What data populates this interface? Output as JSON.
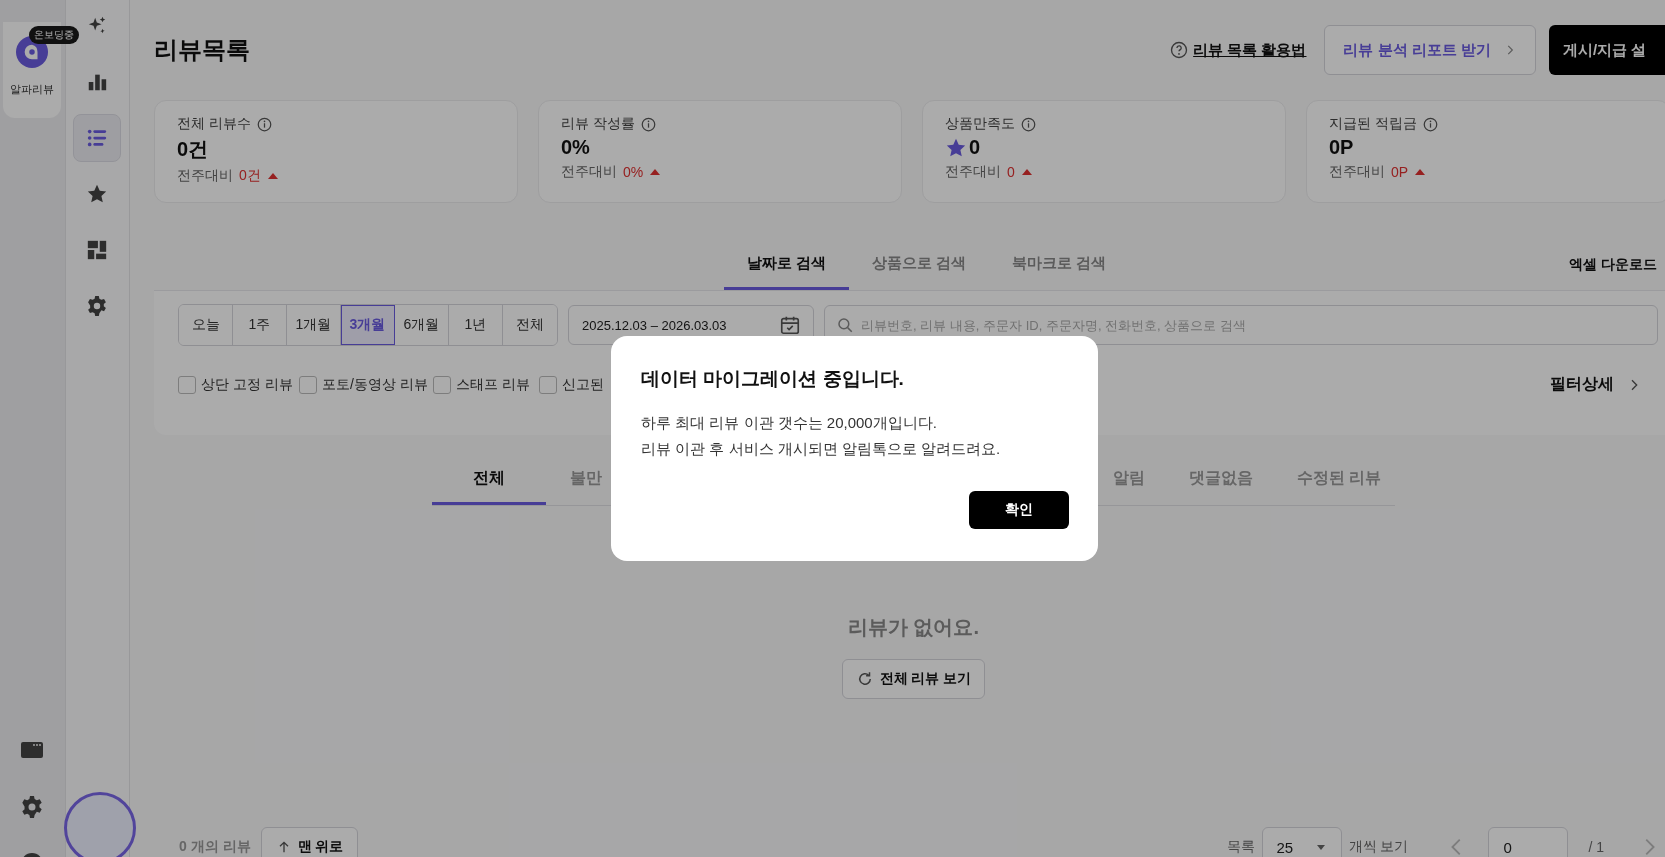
{
  "app_rail": {
    "badge": "온보딩중",
    "app_name": "알파리뷰"
  },
  "nav_items": [
    {
      "selected": false
    },
    {
      "selected": false
    },
    {
      "selected": true
    },
    {
      "selected": false
    },
    {
      "selected": false
    },
    {
      "selected": false
    }
  ],
  "header": {
    "title": "리뷰목록",
    "help_link": "리뷰 목록 활용법",
    "report_button": "리뷰 분석 리포트 받기",
    "settings_button": "게시/지급 설"
  },
  "stats": [
    {
      "kind": "count",
      "label": "전체 리뷰수",
      "value": "0건",
      "compare_label": "전주대비",
      "change": "0건",
      "rising": true
    },
    {
      "kind": "count",
      "label": "리뷰 작성률",
      "value": "0%",
      "compare_label": "전주대비",
      "change": "0%",
      "rising": true
    },
    {
      "kind": "rating",
      "label": "상품만족도",
      "value": "0",
      "compare_label": "전주대비",
      "change": "0",
      "rising": true
    },
    {
      "kind": "count",
      "label": "지급된 적립금",
      "value": "0P",
      "compare_label": "전주대비",
      "change": "0P",
      "rising": true
    }
  ],
  "search_tabs": [
    {
      "label": "날짜로 검색",
      "selected": true
    },
    {
      "label": "상품으로 검색",
      "selected": false
    },
    {
      "label": "북마크로 검색",
      "selected": false
    }
  ],
  "excel_download": "엑셀 다운로드",
  "periods": [
    {
      "label": "오늘",
      "selected": false
    },
    {
      "label": "1주",
      "selected": false
    },
    {
      "label": "1개월",
      "selected": false
    },
    {
      "label": "3개월",
      "selected": true
    },
    {
      "label": "6개월",
      "selected": false
    },
    {
      "label": "1년",
      "selected": false
    },
    {
      "label": "전체",
      "selected": false
    }
  ],
  "date_range": "2025.12.03 – 2026.03.03",
  "search": {
    "placeholder": "리뷰번호, 리뷰 내용, 주문자 ID, 주문자명, 전화번호, 상품으로 검색"
  },
  "filters": [
    {
      "label": "상단 고정 리뷰",
      "checked": false
    },
    {
      "label": "포토/동영상 리뷰",
      "checked": false
    },
    {
      "label": "스태프 리뷰",
      "checked": false
    },
    {
      "label": "신고된",
      "checked": false
    }
  ],
  "filter_detail": "필터상세",
  "review_tabs": [
    {
      "label": "전체",
      "selected": true
    },
    {
      "label": "불만",
      "selected": false
    },
    {
      "label": "알림",
      "selected": false
    },
    {
      "label": "댓글없음",
      "selected": false
    },
    {
      "label": "수정된 리뷰",
      "selected": false
    }
  ],
  "empty_state": {
    "message": "리뷰가 없어요.",
    "button": "전체 리뷰 보기"
  },
  "footer": {
    "count": "0 개의 리뷰",
    "top_button": "맨 위로",
    "list_label": "목록",
    "page_size": "25",
    "per_page_label": "개씩 보기",
    "page": "0",
    "total_pages": "/ 1"
  },
  "dialog": {
    "title": "데이터 마이그레이션 중입니다.",
    "lines": [
      "하루 최대 리뷰 이관 갯수는 20,000개입니다.",
      "리뷰 이관 후 서비스 개시되면 알림톡으로 알려드려요."
    ],
    "confirm_button": "확인"
  }
}
